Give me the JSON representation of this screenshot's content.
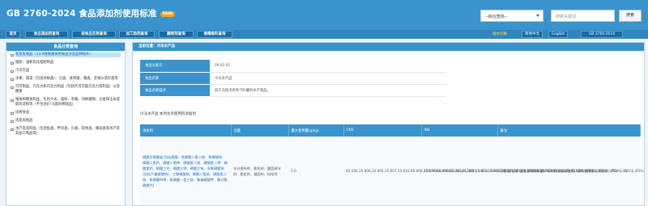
{
  "header": {
    "title": "GB 2760-2024 食品添加剂使用标准",
    "badge": "NEW",
    "select_value": "--综合查找--",
    "search_placeholder": "搜索关键词",
    "search_button": "搜索"
  },
  "nav": {
    "items": [
      "首页",
      "食品添加剂查询",
      "按食品名称查询",
      "加工助剂查询",
      "酶制剂查询",
      "香精香料查询"
    ],
    "version_label": "版本切换",
    "lang_zh": "简体中文",
    "lang_en": "English",
    "std_version": "GB 2760-2014"
  },
  "sidebar": {
    "title": "食品分类查询",
    "items": [
      "乳及乳制品（13.0特殊膳食用食品涉及品种除外）",
      "脂肪、油和乳化脂肪制品",
      "冷冻饮品",
      "水果、蔬菜（包括块根类）、豆类、食用菌、藻类、坚果以及籽类等",
      "可可制品、巧克力和巧克力制品（包括代可可脂巧克力及制品）以及糖果",
      "粮食和粮食制品，包括大米、面粉、杂粮、块根植物、豆类和玉米提取的淀粉等（不包括07.0类焙烤制品）",
      "焙烤食品",
      "肉及肉制品",
      "水产及其制品（包括鱼类、甲壳类、贝类、软体类、棘皮类等水产及其加工制品等）"
    ]
  },
  "content": {
    "breadcrumb": "当前位置：冷冻水产品",
    "info": [
      {
        "key": "食品分类号",
        "value": "09.02.01"
      },
      {
        "key": "食品名称",
        "value": "冷冻水产品"
      },
      {
        "key": "食品名称描述",
        "value": "低于冻结点条件下贮藏的水产制品。"
      }
    ],
    "section_title": "冷冻水产品 本项允许使用的添加剂",
    "table": {
      "headers": [
        "添加剂",
        "功能",
        "最大使用量(g/kg)",
        "CNS",
        "INS",
        "备注"
      ],
      "rows": [
        {
          "additive": "磷酸及磷酸盐(包括磷酸、焦磷酸二氢二钠、焦磷酸钠、磷酸二氢钙、磷酸二氢钾、磷酸氢二铵、磷酸氢二钾、磷酸氢钙、磷酸三钙、磷酸三钾、磷酸三钠、多聚磷酸钠(包括六偏磷酸钠)、三聚磷酸钠、磷酸二氢钠、磷酸氢二钠、焦磷酸四钾、焦磷酸一氢三钠、聚偏磷酸钾、酸式焦磷酸钙)",
          "function": "水分保持剂、膨松剂、酸度调节剂、稳定剂、凝固剂、抗结剂",
          "max": "5.0",
          "cns": "01.106,15.008,15.004,15.007,15.010,06.008,15.009,06.006,02.003,01.308,15.001,15.002,15.003,15.005,15.006,15.017,15.013,15.015,15.016",
          "ins": "338,450(i),450(iii),341(i),340(i),342(ii),340(ii),341(ii),341(iii),340(iii),339(iii),452(i),451(i),339(i),339(ii),450(v),450(ii),452(ii),450(vii)",
          "remark": "不包括\"混淆\"工艺制得的磷酸。可单独或混合使用，最大使用量以磷酸根（PO₄³⁻）计"
        }
      ]
    }
  }
}
